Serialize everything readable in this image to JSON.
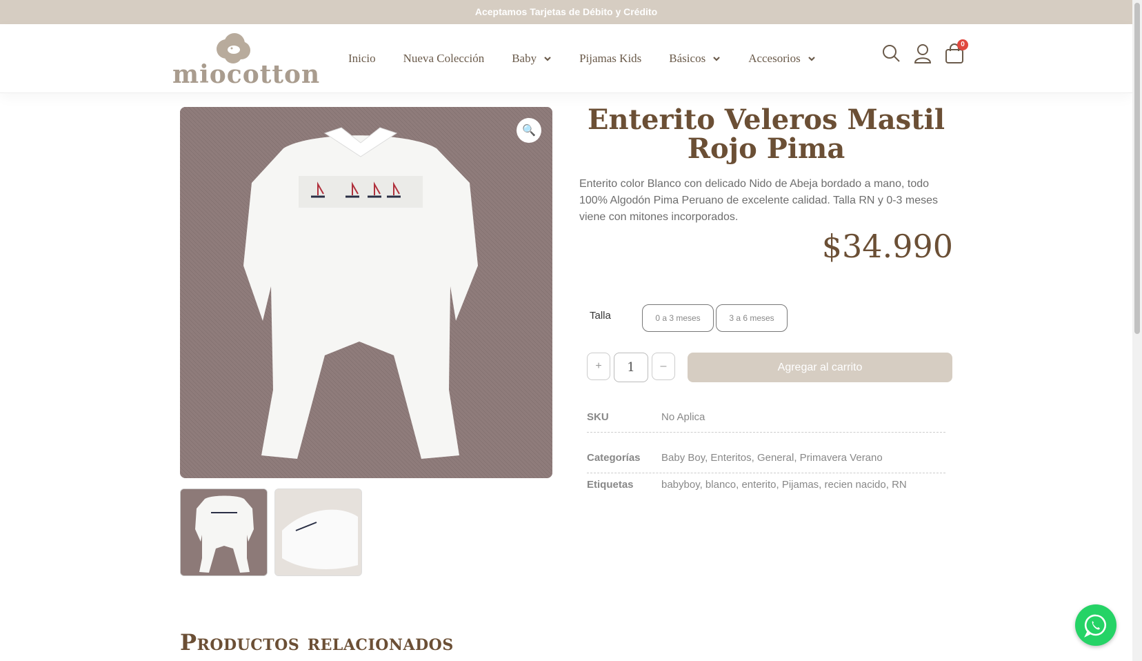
{
  "topbar": {
    "text": "Aceptamos Tarjetas de Débito y Crédito"
  },
  "brand": {
    "logo_text": "miocotton"
  },
  "nav": {
    "items": [
      {
        "label": "Inicio",
        "has_dropdown": false
      },
      {
        "label": "Nueva Colección",
        "has_dropdown": false
      },
      {
        "label": "Baby",
        "has_dropdown": true
      },
      {
        "label": "Pijamas Kids",
        "has_dropdown": false
      },
      {
        "label": "Básicos",
        "has_dropdown": true
      },
      {
        "label": "Accesorios",
        "has_dropdown": true
      }
    ]
  },
  "header_icons": {
    "search": "search-icon",
    "account": "user-icon",
    "cart": "cart-icon",
    "cart_count": "0"
  },
  "product": {
    "title": "Enterito Veleros Mastil Rojo Pima",
    "description": "Enterito color Blanco con delicado Nido de Abeja bordado a mano, todo 100% Algodón Pima Peruano de excelente calidad. Talla RN y 0-3 meses viene con mitones incorporados.",
    "price": "$34.990",
    "talla_label": "Talla",
    "talla_options": [
      "0 a 3 meses",
      "3 a 6 meses"
    ],
    "quantity": "1",
    "qty_plus": "+",
    "qty_minus": "–",
    "add_to_cart": "Agregar al carrito",
    "zoom_icon": "🔍"
  },
  "meta": {
    "sku_label": "SKU",
    "sku_value": "No Aplica",
    "categories_label": "Categorías",
    "categories_value": "Baby Boy, Enteritos, General, Primavera Verano",
    "tags_label": "Etiquetas",
    "tags_value": "babyboy, blanco, enterito, Pijamas, recien nacido, RN"
  },
  "related": {
    "title": "Productos relacionados"
  },
  "colors": {
    "accent": "#6b4f35",
    "topbar": "#d6cdc2",
    "whatsapp": "#25d366",
    "badge": "#e0483e"
  }
}
